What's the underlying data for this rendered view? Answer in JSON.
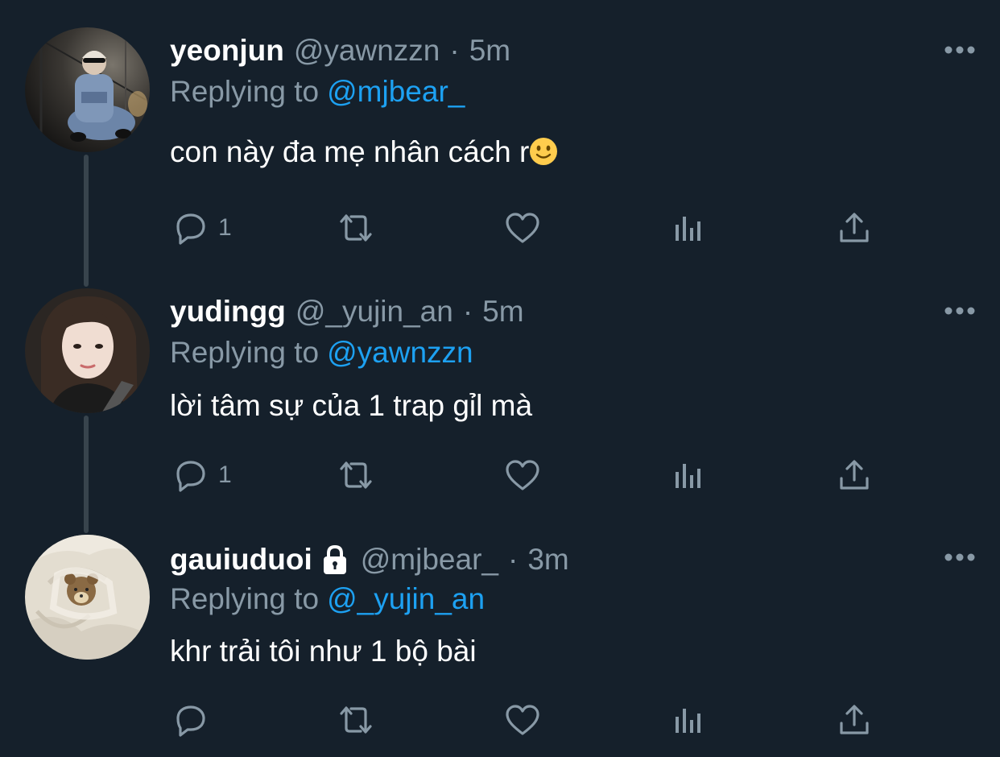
{
  "colors": {
    "background": "#15202b",
    "primary_text": "#ffffff",
    "secondary_text": "#8899a6",
    "mention": "#1da1f2",
    "thread_line": "#38444d"
  },
  "tweets": [
    {
      "name": "yeonjun",
      "handle": "@yawnzzn",
      "separator": "·",
      "time": "5m",
      "replying_label": "Replying to",
      "replying_to": "@mjbear_",
      "text": "con này đa mẹ nhân cách r",
      "emoji": "slightly-smiling-face",
      "reply_count": "1",
      "avatar": "person-in-denim-sitting-avatar"
    },
    {
      "name": "yudingg",
      "handle": "@_yujin_an",
      "separator": "·",
      "time": "5m",
      "replying_label": "Replying to",
      "replying_to": "@yawnzzn",
      "text": "lời tâm sự của 1 trap gỉl mà",
      "reply_count": "1",
      "avatar": "woman-selfie-avatar"
    },
    {
      "name": "gauiuduoi",
      "handle": "@mjbear_",
      "separator": "·",
      "time": "3m",
      "replying_label": "Replying to",
      "replying_to": "@_yujin_an",
      "text": "khr trải tôi như 1 bộ bài",
      "reply_count": "",
      "protected_icon": "lock-icon",
      "avatar": "teddy-bear-in-blanket-avatar"
    }
  ],
  "icons": [
    "reply-icon",
    "retweet-icon",
    "like-icon",
    "analytics-icon",
    "share-icon",
    "more-icon"
  ]
}
